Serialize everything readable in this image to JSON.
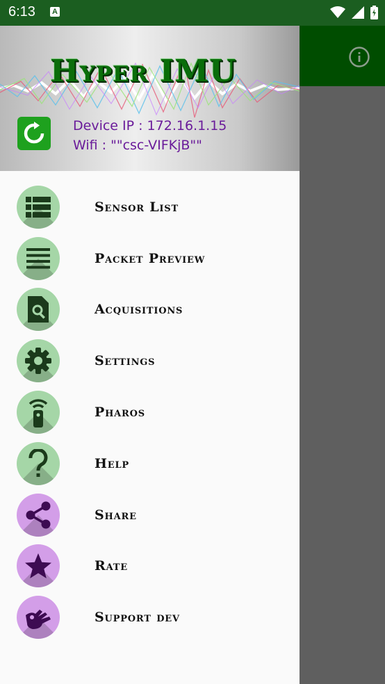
{
  "status_bar": {
    "time": "6:13",
    "notification": "A"
  },
  "drawer": {
    "brand": "Hyper IMU",
    "device_ip": "Device IP : 172.16.1.15",
    "wifi": "Wifi : \"\"csc-VIFKjB\"\""
  },
  "menu": [
    {
      "label": "Sensor List",
      "icon": "list-icon",
      "color": "#a5d6a7"
    },
    {
      "label": "Packet Preview",
      "icon": "lines-icon",
      "color": "#a5d6a7"
    },
    {
      "label": "Acquisitions",
      "icon": "file-search-icon",
      "color": "#a5d6a7"
    },
    {
      "label": "Settings",
      "icon": "gear-icon",
      "color": "#a5d6a7"
    },
    {
      "label": "Pharos",
      "icon": "remote-icon",
      "color": "#a5d6a7"
    },
    {
      "label": "Help",
      "icon": "question-icon",
      "color": "#a5d6a7"
    },
    {
      "label": "Share",
      "icon": "share-icon",
      "color": "#d39ee8"
    },
    {
      "label": "Rate",
      "icon": "star-icon",
      "color": "#d39ee8"
    },
    {
      "label": "Support dev",
      "icon": "hand-ok-icon",
      "color": "#d39ee8"
    }
  ],
  "colors": {
    "status_bar": "#1b5e20",
    "app_bar": "#004d00",
    "icon_dark_green": "#1b3a1b",
    "icon_dark_purple": "#3d0b52",
    "info_text": "#6a1b9a"
  }
}
